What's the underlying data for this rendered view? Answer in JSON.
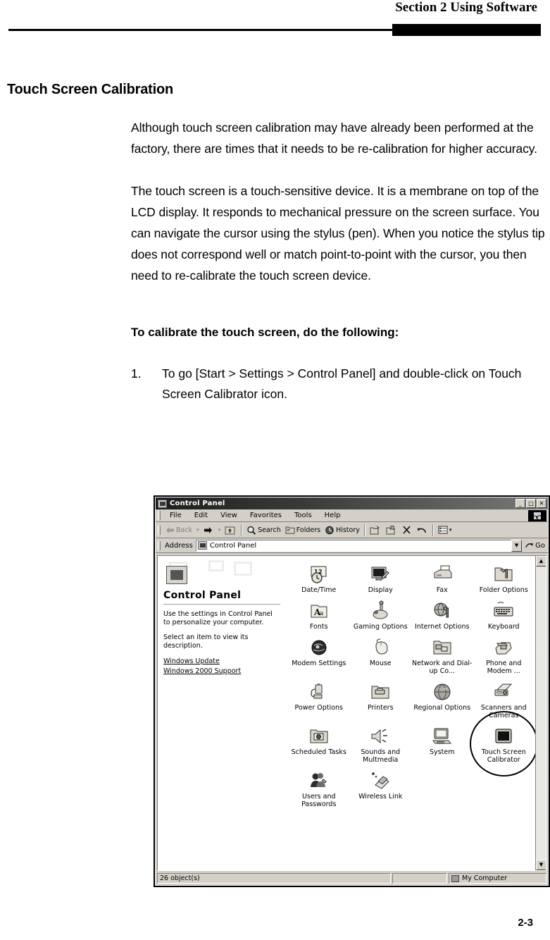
{
  "header": {
    "running_head": "Section 2 Using Software"
  },
  "page": {
    "number": "2-3",
    "heading": "Touch Screen Calibration",
    "paragraphs": [
      "Although touch screen calibration may have already been performed at the factory, there are times that it needs to be re-calibration for higher accuracy.",
      "The touch screen is a touch-sensitive device. It is a membrane on top of the LCD display. It responds to mechanical pressure on the screen surface. You can navigate the cursor using the stylus (pen). When you notice the stylus tip does not correspond well or match point-to-point with the cursor, you then need to re-calibrate the touch screen device."
    ],
    "lead_in": "To calibrate the touch screen, do the following:",
    "steps": [
      {
        "number": "1.",
        "text": "To go [Start > Settings > Control Panel] and double-click on Touch Screen Calibrator icon."
      }
    ]
  },
  "control_panel": {
    "title": "Control Panel",
    "window_buttons": {
      "minimize": "_",
      "maximize": "□",
      "close": "✕"
    },
    "menu": [
      "File",
      "Edit",
      "View",
      "Favorites",
      "Tools",
      "Help"
    ],
    "toolbar": [
      {
        "label": "Back",
        "icon": "back-arrow-icon",
        "disabled": true
      },
      {
        "label": "",
        "icon": "forward-arrow-icon",
        "disabled": false
      },
      {
        "label": "",
        "icon": "up-folder-icon",
        "disabled": false
      },
      {
        "label": "Search",
        "icon": "search-icon",
        "disabled": false
      },
      {
        "label": "Folders",
        "icon": "folders-icon",
        "disabled": false
      },
      {
        "label": "History",
        "icon": "history-icon",
        "disabled": false
      },
      {
        "label": "",
        "icon": "move-to-icon",
        "disabled": false
      },
      {
        "label": "",
        "icon": "copy-to-icon",
        "disabled": false
      },
      {
        "label": "",
        "icon": "delete-x-icon",
        "disabled": false
      },
      {
        "label": "",
        "icon": "undo-icon",
        "disabled": false
      },
      {
        "label": "",
        "icon": "views-icon",
        "disabled": false
      }
    ],
    "address": {
      "label": "Address",
      "value": "Control Panel",
      "go_label": "Go"
    },
    "left_pane": {
      "title": "Control Panel",
      "description_1": "Use the settings in Control Panel to personalize your computer.",
      "description_2": "Select an item to view its description.",
      "links": [
        "Windows Update",
        "Windows 2000 Support"
      ]
    },
    "icons": [
      {
        "label": "Date/Time",
        "icon": "date-time-icon"
      },
      {
        "label": "Display",
        "icon": "display-icon"
      },
      {
        "label": "Fax",
        "icon": "fax-icon"
      },
      {
        "label": "Folder Options",
        "icon": "folder-options-icon"
      },
      {
        "label": "Fonts",
        "icon": "fonts-icon"
      },
      {
        "label": "Gaming Options",
        "icon": "gaming-options-icon"
      },
      {
        "label": "Internet Options",
        "icon": "internet-options-icon"
      },
      {
        "label": "Keyboard",
        "icon": "keyboard-icon"
      },
      {
        "label": "Modem Settings",
        "icon": "modem-settings-icon"
      },
      {
        "label": "Mouse",
        "icon": "mouse-icon"
      },
      {
        "label": "Network and Dial-up Co...",
        "icon": "network-dialup-icon"
      },
      {
        "label": "Phone and Modem ...",
        "icon": "phone-modem-icon"
      },
      {
        "label": "Power Options",
        "icon": "power-options-icon"
      },
      {
        "label": "Printers",
        "icon": "printers-icon"
      },
      {
        "label": "Regional Options",
        "icon": "regional-options-icon"
      },
      {
        "label": "Scanners and Cameras",
        "icon": "scanners-cameras-icon"
      },
      {
        "label": "Scheduled Tasks",
        "icon": "scheduled-tasks-icon"
      },
      {
        "label": "Sounds and Multmedia",
        "icon": "sounds-multimedia-icon"
      },
      {
        "label": "System",
        "icon": "system-icon"
      },
      {
        "label": "Touch Screen Calibrator",
        "icon": "touch-screen-calibrator-icon",
        "highlighted": true
      },
      {
        "label": "Users and Passwords",
        "icon": "users-passwords-icon"
      },
      {
        "label": "Wireless Link",
        "icon": "wireless-link-icon"
      }
    ],
    "status_bar": {
      "object_count": "26 object(s)",
      "middle": "",
      "zone": "My Computer"
    },
    "scrollbar": {
      "up": "▲",
      "down": "▼"
    }
  },
  "colors": {
    "window_face": "#d4d0c8",
    "title_bar_dark": "#1d1d1d",
    "text": "#000000",
    "page_bg": "#ffffff"
  }
}
